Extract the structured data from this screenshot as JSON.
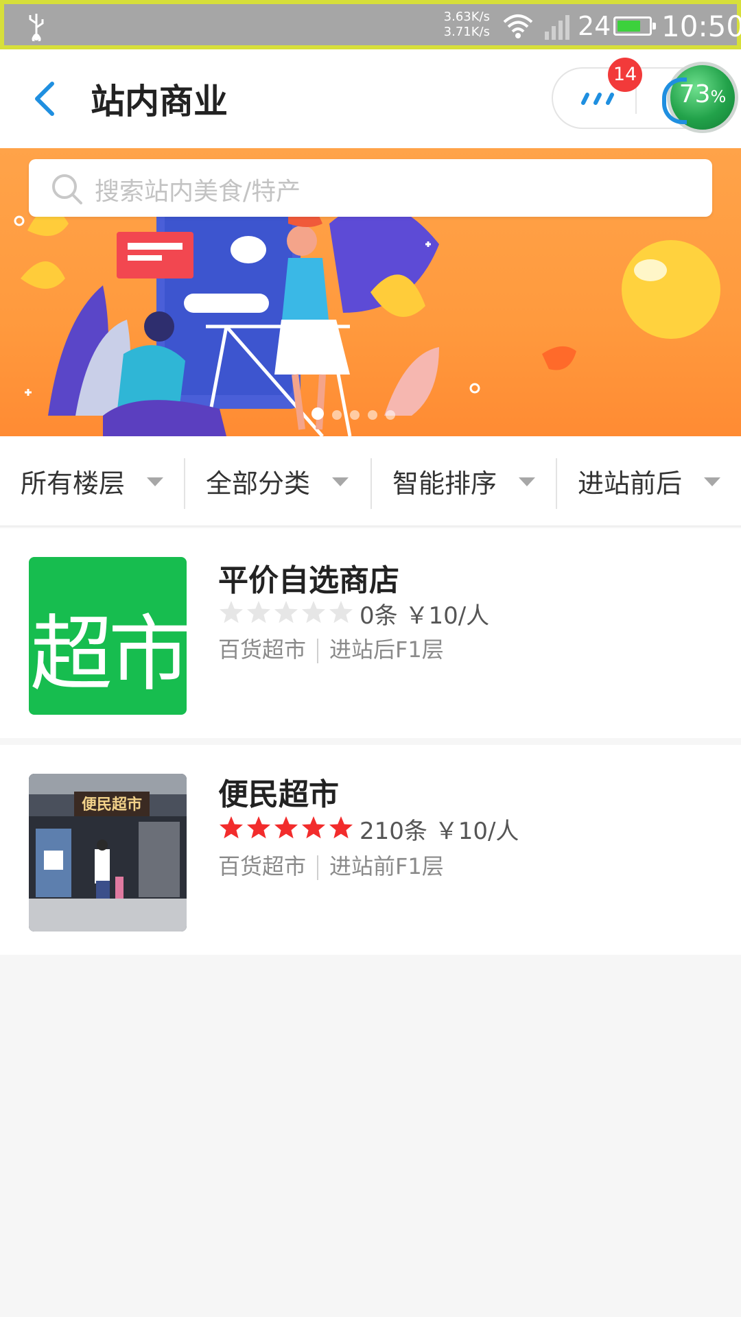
{
  "status_bar": {
    "speed_up": "3.63K/s",
    "speed_down": "3.71K/s",
    "battery_level": "24",
    "time": "10:50"
  },
  "header": {
    "title": "站内商业",
    "badge_count": "14",
    "percent_value": "73",
    "percent_unit": "%"
  },
  "search": {
    "placeholder": "搜索站内美食/特产"
  },
  "filters": [
    {
      "label": "所有楼层"
    },
    {
      "label": "全部分类"
    },
    {
      "label": "智能排序"
    },
    {
      "label": "进站前后"
    }
  ],
  "shops": [
    {
      "name": "平价自选商店",
      "thumbnail_text": "超市",
      "rating": 0,
      "review_count": "0条",
      "price": "￥10/人",
      "category": "百货超市",
      "location": "进站后F1层"
    },
    {
      "name": "便民超市",
      "thumbnail_text": "便民超市",
      "rating": 5,
      "review_count": "210条",
      "price": "￥10/人",
      "category": "百货超市",
      "location": "进站前F1层"
    }
  ],
  "colors": {
    "accent_blue": "#1f8fe0",
    "banner_orange": "#ff9a3e",
    "star_active": "#f22c2c",
    "star_inactive": "#e6e6e6",
    "badge_red": "#f23a3a"
  }
}
